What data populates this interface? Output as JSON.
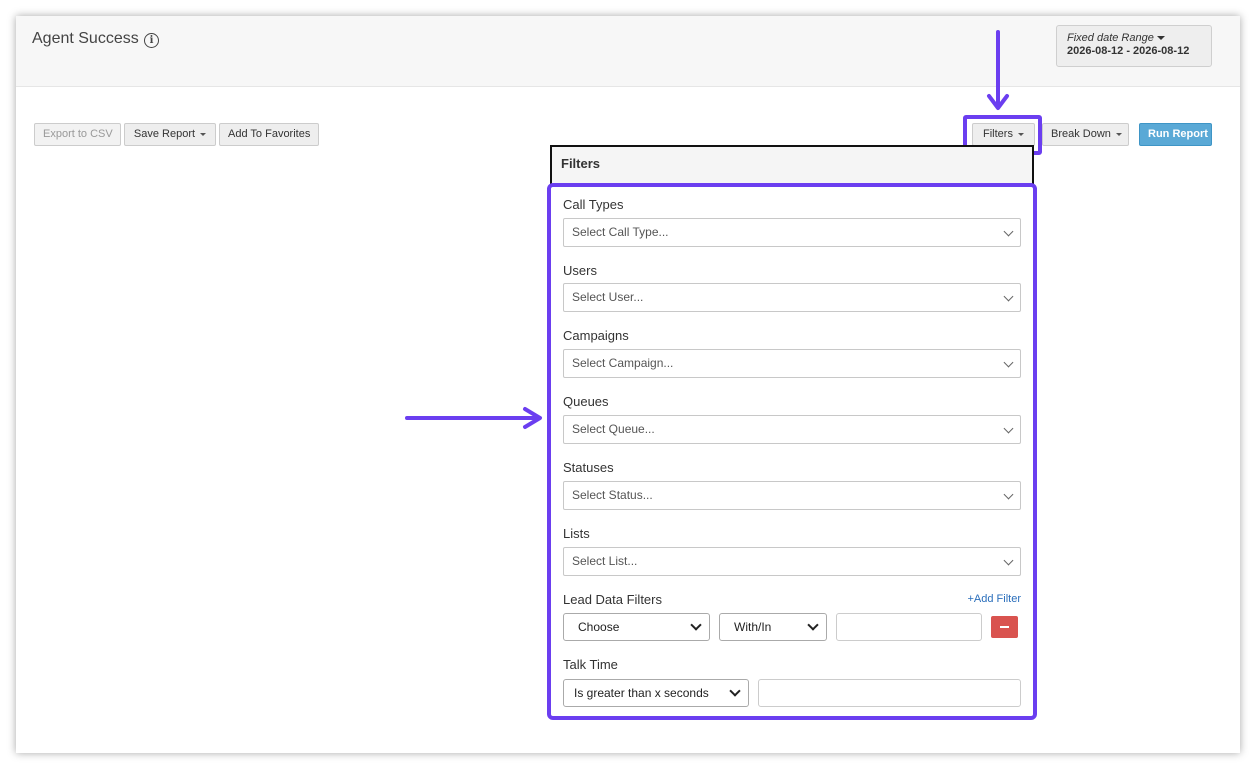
{
  "header": {
    "title": "Agent Success",
    "info_icon": "info-icon",
    "date_range": {
      "label": "Fixed date Range",
      "value": "2026-08-12 - 2026-08-12"
    }
  },
  "toolbar": {
    "export_csv": "Export to CSV",
    "save_report": "Save Report",
    "add_favorites": "Add To Favorites",
    "filters": "Filters",
    "break_down": "Break Down",
    "run_report": "Run Report"
  },
  "filters_panel": {
    "title": "Filters",
    "call_types": {
      "label": "Call Types",
      "placeholder": "Select Call Type..."
    },
    "users": {
      "label": "Users",
      "placeholder": "Select User..."
    },
    "campaigns": {
      "label": "Campaigns",
      "placeholder": "Select Campaign..."
    },
    "queues": {
      "label": "Queues",
      "placeholder": "Select Queue..."
    },
    "statuses": {
      "label": "Statuses",
      "placeholder": "Select Status..."
    },
    "lists": {
      "label": "Lists",
      "placeholder": "Select List..."
    },
    "lead_data": {
      "label": "Lead Data Filters",
      "add_filter": "+Add Filter",
      "field_select": "Choose",
      "operator_select": "With/In",
      "value": ""
    },
    "talk_time": {
      "label": "Talk Time",
      "operator_select": "Is greater than x seconds",
      "value": ""
    }
  },
  "colors": {
    "highlight": "#6b3ef0",
    "run_report": "#5aa9d6",
    "remove_button": "#d9534f",
    "link": "#2a6ebb"
  }
}
